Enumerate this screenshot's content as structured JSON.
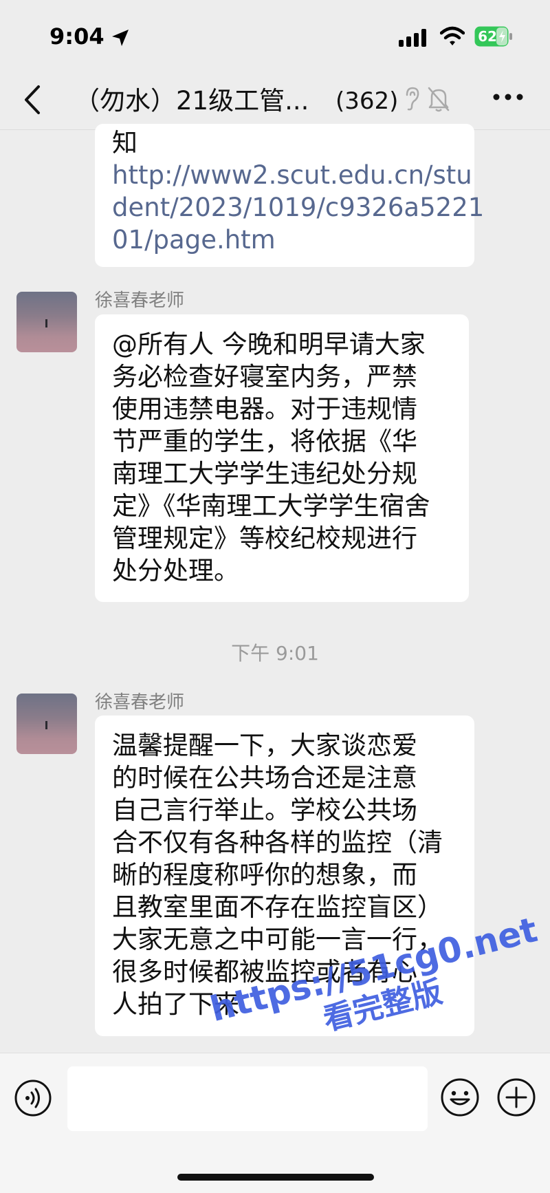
{
  "status_bar": {
    "time": "9:04",
    "battery": "62"
  },
  "header": {
    "title": "（勿水）21级工管...",
    "member_count": "(362)"
  },
  "messages": [
    {
      "kind": "partial",
      "lines": [
        "知"
      ],
      "link_lines": [
        "http://www2.scut.edu.cn/stu",
        "dent/2023/1019/c9326a5221",
        "01/page.htm"
      ]
    },
    {
      "sender": "徐喜春老师",
      "lines": [
        "@所有人 今晚和明早请大家",
        "务必检查好寝室内务，严禁",
        "使用违禁电器。对于违规情",
        "节严重的学生，将依据《华",
        "南理工大学学生违纪处分规",
        "定》《华南理工大学学生宿舍",
        "管理规定》等校纪校规进行",
        "处分处理。"
      ]
    },
    {
      "timestamp": "下午 9:01"
    },
    {
      "sender": "徐喜春老师",
      "lines": [
        "温馨提醒一下，大家谈恋爱",
        "的时候在公共场合还是注意",
        "自己言行举止。学校公共场",
        "合不仅有各种各样的监控（清",
        "晰的程度称呼你的想象，而",
        "且教室里面不存在监控盲区）",
        "大家无意之中可能一言一行，",
        "很多时候都被监控或者有心",
        "人拍了下来"
      ]
    }
  ],
  "watermark": {
    "line1": "https://51cg0.net",
    "line2": "看完整版"
  },
  "icons": [
    "location-arrow-icon",
    "signal-icon",
    "wifi-icon",
    "battery-icon",
    "back-arrow-icon",
    "ear-icon",
    "mute-bell-icon",
    "more-icon",
    "voice-icon",
    "emoji-icon",
    "plus-icon"
  ]
}
